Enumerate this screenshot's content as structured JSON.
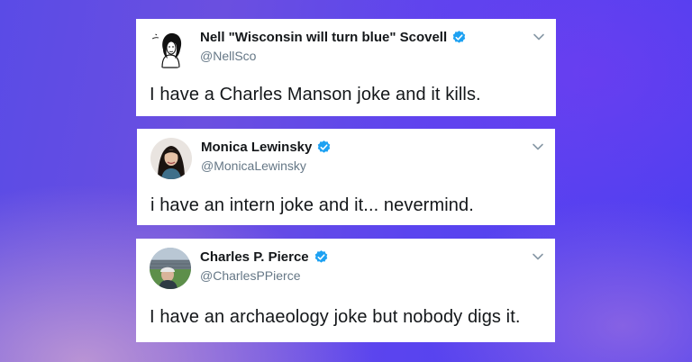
{
  "tweets": [
    {
      "name": "Nell \"Wisconsin will turn blue\" Scovell",
      "handle": "@NellSco",
      "text": "I have a Charles Manson joke and it kills.",
      "avatar_icon": "sketch-portrait-avatar"
    },
    {
      "name": "Monica Lewinsky",
      "handle": "@MonicaLewinsky",
      "text": "i have an intern joke and it... nevermind.",
      "avatar_icon": "photo-portrait-avatar"
    },
    {
      "name": "Charles P. Pierce",
      "handle": "@CharlesPPierce",
      "text": "I have an archaeology joke but nobody digs it.",
      "avatar_icon": "stadium-portrait-avatar"
    }
  ],
  "colors": {
    "verified_blue": "#1da1f2",
    "handle_gray": "#657786",
    "text_dark": "#14171a",
    "chevron_gray": "#8899a6"
  }
}
